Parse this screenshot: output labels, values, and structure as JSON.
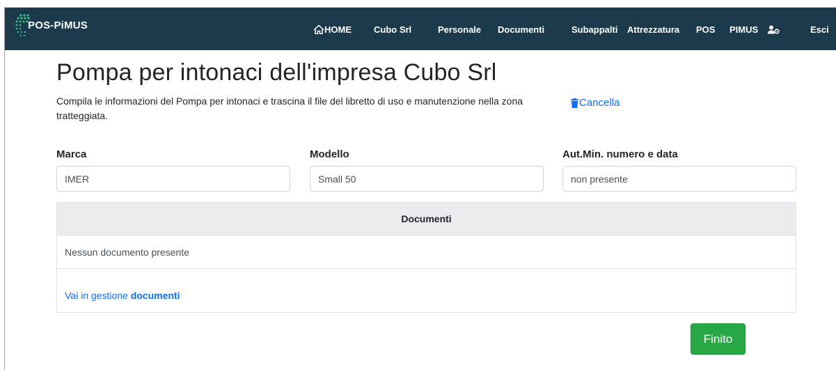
{
  "navbar": {
    "brand": "POS-PiMUS",
    "items": [
      {
        "label": "HOME",
        "icon": "home-icon"
      },
      {
        "label": "Cubo Srl"
      },
      {
        "label": "Personale"
      },
      {
        "label": "Documenti"
      },
      {
        "label": "Subappalti"
      },
      {
        "label": "Attrezzatura"
      },
      {
        "label": "POS"
      },
      {
        "label": "PIMUS"
      },
      {
        "label": "",
        "icon": "user-settings-icon"
      },
      {
        "label": "Esci"
      }
    ],
    "colors": {
      "background": "#1b3a4b",
      "logo_dots": "#3cc47c",
      "text": "#ffffff"
    }
  },
  "page": {
    "title": "Pompa per intonaci dell'impresa Cubo Srl",
    "description": "Compila le informazioni del Pompa per intonaci e trascina il file del libretto di uso e manutenzione nella zona tratteggiata.",
    "delete_label": "Cancella",
    "delete_icon": "trash-icon"
  },
  "form": {
    "marca": {
      "label": "Marca",
      "value": "IMER"
    },
    "modello": {
      "label": "Modello",
      "value": "Small 50"
    },
    "aut_min": {
      "label": "Aut.Min. numero e data",
      "value": "non presente"
    }
  },
  "documents": {
    "header": "Documenti",
    "empty_text": "Nessun documento presente",
    "manage_prefix": "Vai in gestione ",
    "manage_link": "documenti"
  },
  "actions": {
    "finish_label": "Finito",
    "finish_color": "#28a745",
    "link_color": "#0d6efd"
  }
}
